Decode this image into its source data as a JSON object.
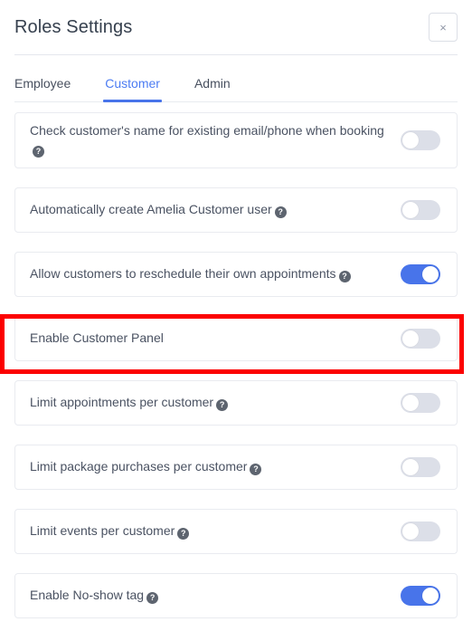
{
  "modal": {
    "title": "Roles Settings",
    "close_label": "×",
    "close_icon": "close-icon"
  },
  "tabs": [
    {
      "label": "Employee",
      "active": false
    },
    {
      "label": "Customer",
      "active": true
    },
    {
      "label": "Admin",
      "active": false
    }
  ],
  "settings": [
    {
      "label": "Check customer's name for existing email/phone when booking",
      "has_help": true,
      "help_icon": "question-mark-icon",
      "toggle_on": false,
      "toggle_state": "off",
      "tall": true,
      "highlighted": false
    },
    {
      "label": "Automatically create Amelia Customer user",
      "has_help": true,
      "help_icon": "question-mark-icon",
      "toggle_on": false,
      "toggle_state": "off",
      "tall": false,
      "highlighted": false
    },
    {
      "label": "Allow customers to reschedule their own appointments",
      "has_help": true,
      "help_icon": "question-mark-icon",
      "toggle_on": true,
      "toggle_state": "on",
      "tall": false,
      "highlighted": false
    },
    {
      "label": "Enable Customer Panel",
      "has_help": false,
      "help_icon": "",
      "toggle_on": false,
      "toggle_state": "off",
      "tall": false,
      "highlighted": true
    },
    {
      "label": "Limit appointments per customer",
      "has_help": true,
      "help_icon": "question-mark-icon",
      "toggle_on": false,
      "toggle_state": "off",
      "tall": false,
      "highlighted": false
    },
    {
      "label": "Limit package purchases per customer",
      "has_help": true,
      "help_icon": "question-mark-icon",
      "toggle_on": false,
      "toggle_state": "off",
      "tall": false,
      "highlighted": false
    },
    {
      "label": "Limit events per customer",
      "has_help": true,
      "help_icon": "question-mark-icon",
      "toggle_on": false,
      "toggle_state": "off",
      "tall": false,
      "highlighted": false
    },
    {
      "label": "Enable No-show tag",
      "has_help": true,
      "help_icon": "question-mark-icon",
      "toggle_on": true,
      "toggle_state": "on",
      "tall": false,
      "highlighted": false
    }
  ],
  "help_glyph": "?",
  "colors": {
    "accent": "#4874ea",
    "active_tab_text": "#4c7cf3",
    "toggle_off": "#dcdfe8",
    "toggle_on": "#4874ea",
    "title_text": "#36404e",
    "label_text": "#4a5262",
    "card_border": "#e9ebf0",
    "highlight": "#fc0000"
  }
}
